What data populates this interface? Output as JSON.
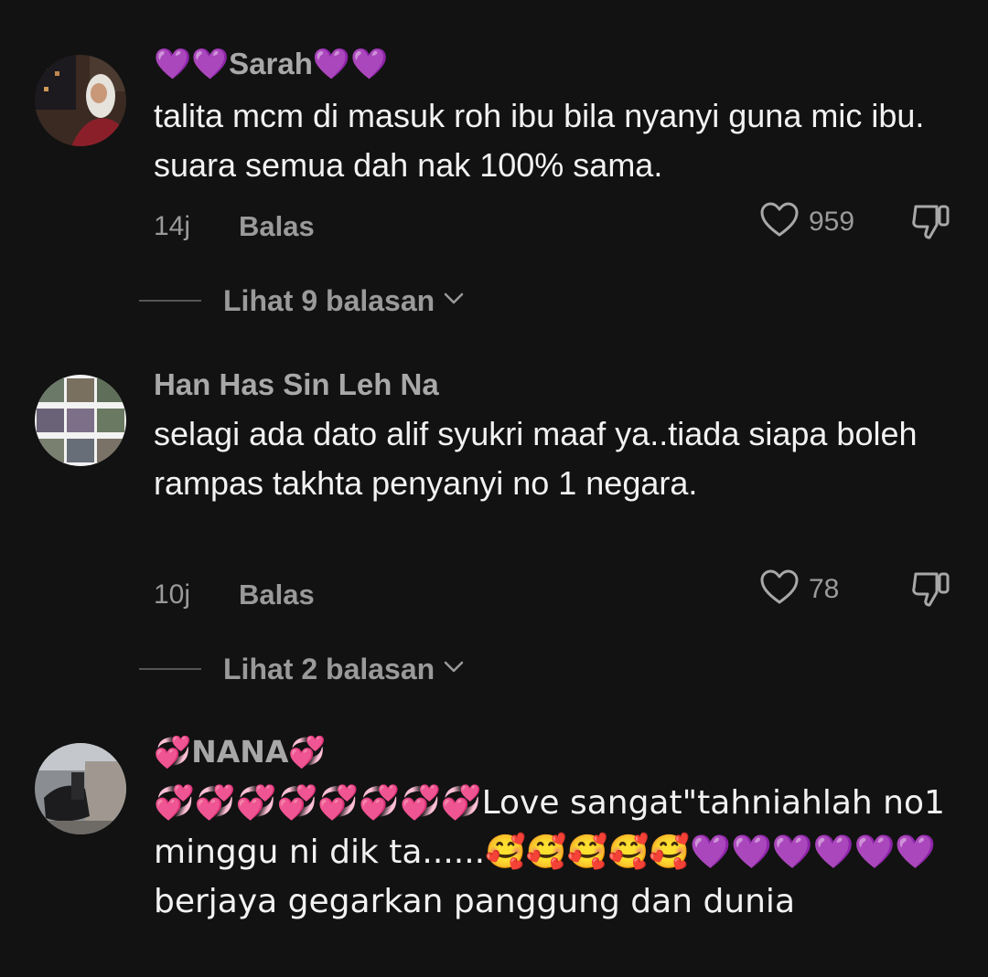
{
  "comments": [
    {
      "username": "💜💜Sarah💜💜",
      "text": "talita mcm di masuk roh ibu bila nyanyi guna mic ibu. suara semua dah nak 100% sama.",
      "time": "14j",
      "reply_label": "Balas",
      "likes": "959",
      "view_replies": "Lihat 9 balasan"
    },
    {
      "username": "Han Has Sin Leh Na",
      "text": "selagi ada dato alif syukri maaf ya..tiada siapa boleh rampas takhta penyanyi no 1 negara.",
      "time": "10j",
      "reply_label": "Balas",
      "likes": "78",
      "view_replies": "Lihat 2 balasan"
    },
    {
      "username": "💞NANA💞",
      "text": "💞💞💞💞💞💞💞💞Love sangat\"tahniahlah no1 minggu ni dik ta......🥰🥰🥰🥰🥰💜💜💜💜💜💜berjaya gegarkan panggung dan dunia"
    }
  ],
  "icons": {
    "like": "heart-outline-icon",
    "dislike": "thumbs-down-icon",
    "expand": "chevron-down-icon"
  },
  "colors": {
    "background": "#121212",
    "primary_text": "#f2f2f2",
    "secondary_text": "#9a9a9a"
  }
}
